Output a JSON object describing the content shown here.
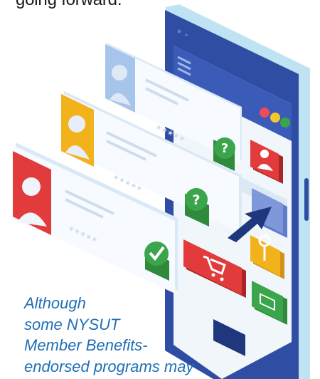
{
  "intro": {
    "line": "going forward."
  },
  "illustration": {
    "subject": "smartphone with profile cards",
    "icons": [
      "user-icon",
      "question-icon",
      "check-icon",
      "cart-icon",
      "location-pin-icon",
      "mail-icon",
      "cursor-arrow-icon"
    ]
  },
  "caption": {
    "lines": [
      "Although",
      "some NYSUT",
      "Member Benefits-",
      "endorsed programs may"
    ]
  },
  "colors": {
    "caption_text": "#1f6fb5",
    "phone_body": "#2f4ea3",
    "red_badge": "#e23b3b",
    "green_badge": "#3aa54a",
    "yellow_badge": "#f2b21c"
  }
}
